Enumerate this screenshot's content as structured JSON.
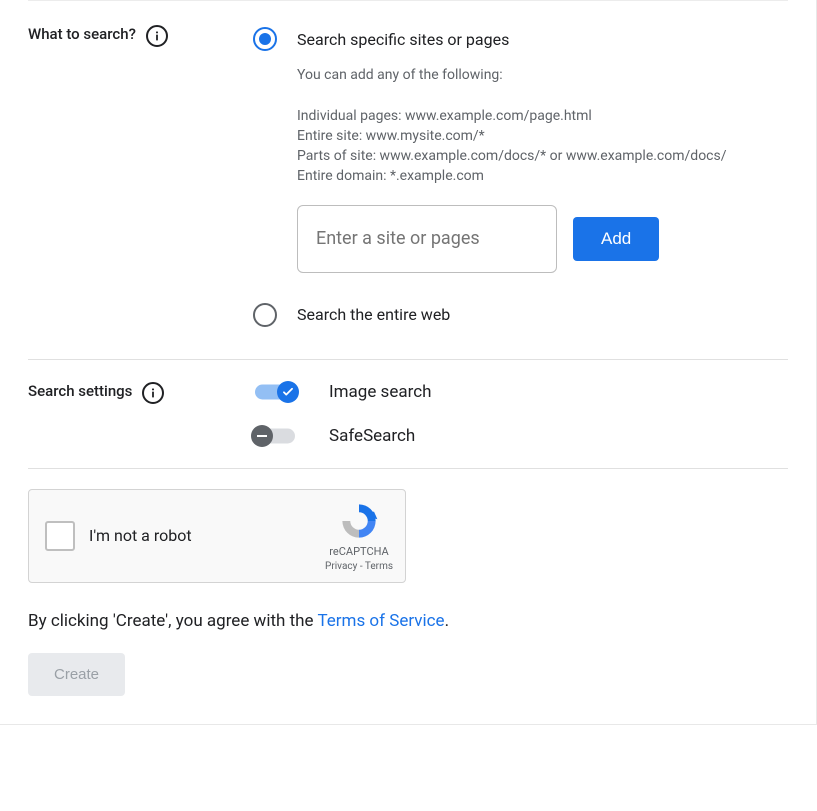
{
  "what_to_search": {
    "label": "What to search?",
    "radio_specific": "Search specific sites or pages",
    "help_intro": "You can add any of the following:",
    "help_line1": "Individual pages: www.example.com/page.html",
    "help_line2": "Entire site: www.mysite.com/*",
    "help_line3": "Parts of site: www.example.com/docs/* or www.example.com/docs/",
    "help_line4": "Entire domain: *.example.com",
    "input_placeholder": "Enter a site or pages",
    "add_label": "Add",
    "radio_entire": "Search the entire web"
  },
  "search_settings": {
    "label": "Search settings",
    "image_search": "Image search",
    "safesearch": "SafeSearch"
  },
  "recaptcha": {
    "label": "I'm not a robot",
    "brand": "reCAPTCHA",
    "privacy": "Privacy",
    "terms": "Terms",
    "sep": " - "
  },
  "agree": {
    "prefix": "By clicking 'Create', you agree with the ",
    "link": "Terms of Service",
    "suffix": "."
  },
  "create_label": "Create"
}
